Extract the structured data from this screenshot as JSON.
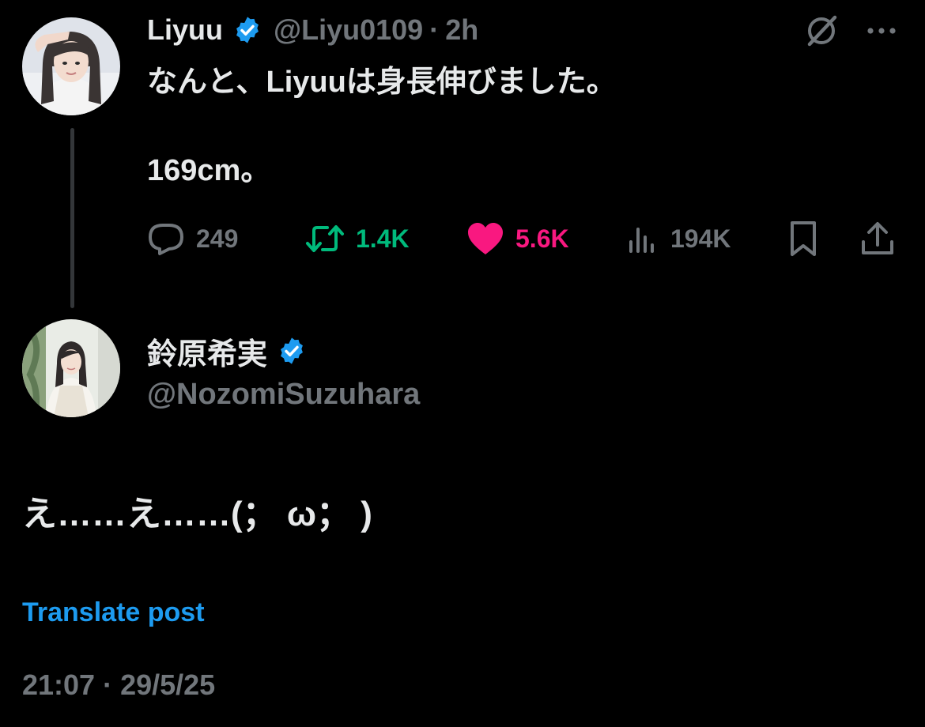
{
  "parent_post": {
    "author": {
      "display_name": "Liyuu",
      "handle": "@Liyu0109",
      "verified": true
    },
    "separator": "·",
    "time": "2h",
    "text": "なんと、Liyuuは身長伸びました。\n\n169cm。",
    "icons": {
      "grok": "grok-icon",
      "more": "more-icon"
    },
    "actions": {
      "replies": "249",
      "reposts": "1.4K",
      "likes": "5.6K",
      "views": "194K"
    }
  },
  "reply_post": {
    "author": {
      "display_name": "鈴原希実",
      "handle": "@NozomiSuzuhara",
      "verified": true
    },
    "text": "え……え……(； ω； )",
    "translate_label": "Translate post",
    "timestamp": "21:07 · 29/5/25"
  },
  "colors": {
    "background": "#000000",
    "text": "#e7e9ea",
    "muted": "#71767b",
    "repost": "#00ba7c",
    "like": "#f91880",
    "link": "#1d9bf0",
    "verified": "#1d9bf0"
  }
}
